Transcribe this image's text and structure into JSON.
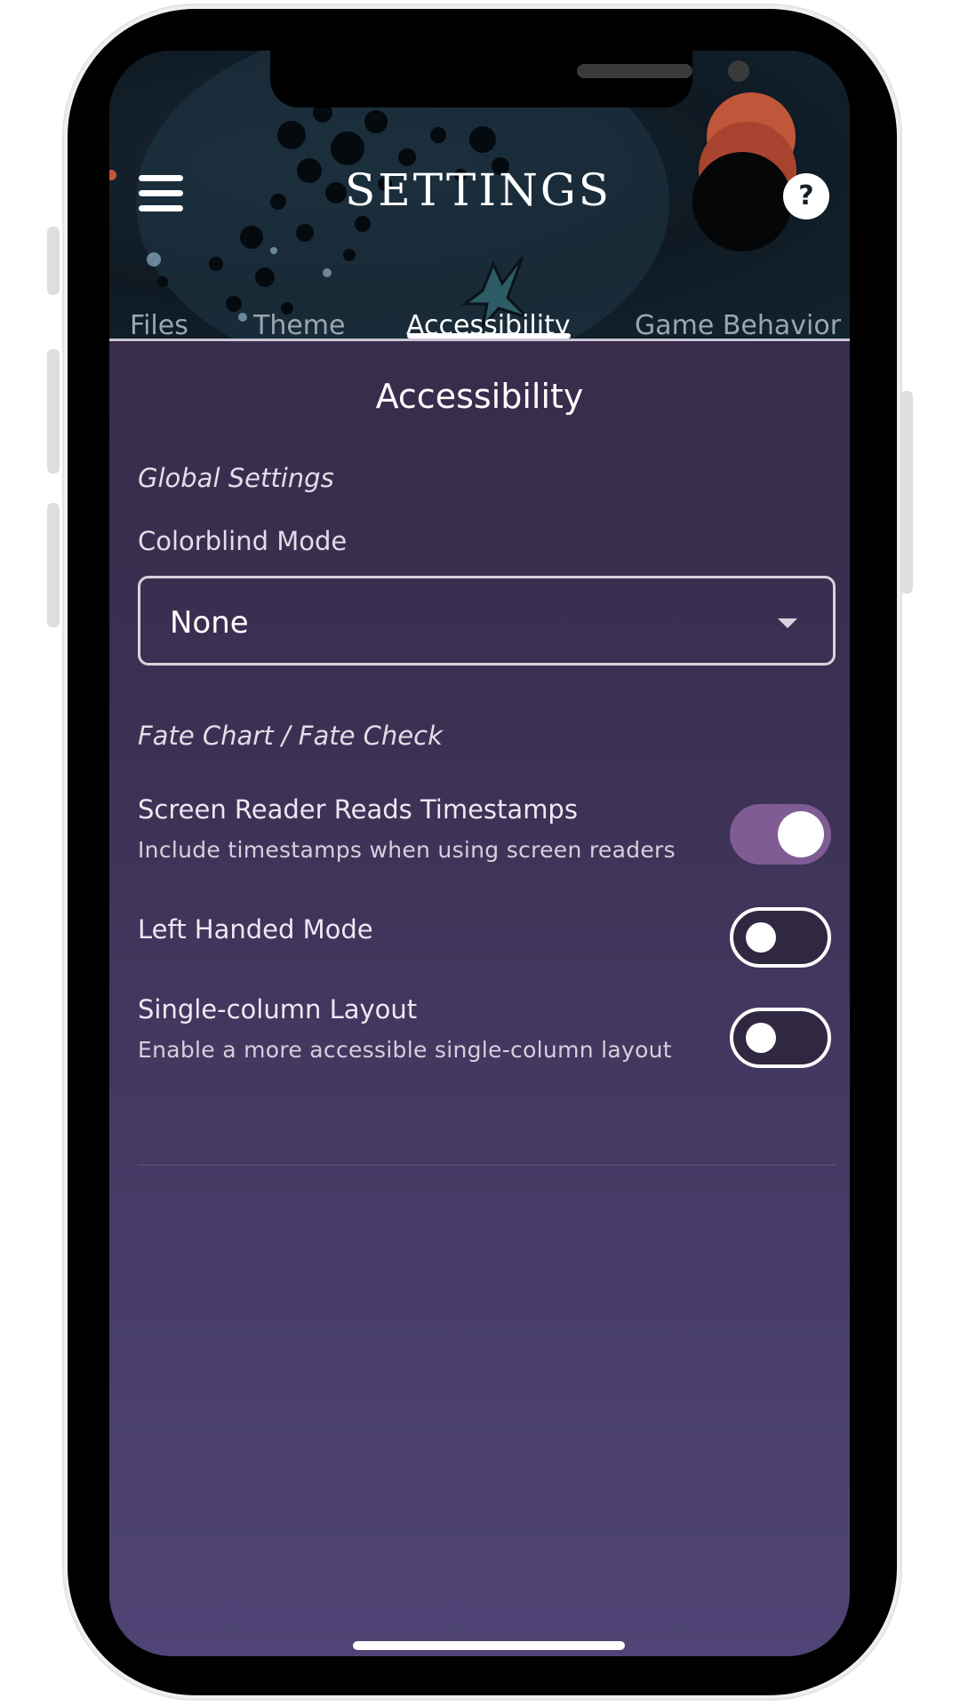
{
  "header": {
    "title": "SETTINGS",
    "menu_icon": "hamburger-menu-icon",
    "help_label": "?"
  },
  "tabs": [
    {
      "label": "Files",
      "active": false
    },
    {
      "label": "Theme",
      "active": false
    },
    {
      "label": "Accessibility",
      "active": true
    },
    {
      "label": "Game Behavior",
      "active": false
    }
  ],
  "content": {
    "section_title": "Accessibility",
    "global_group_label": "Global Settings",
    "colorblind": {
      "label": "Colorblind Mode",
      "selected": "None"
    },
    "fate_group_label": "Fate Chart / Fate Check",
    "settings": [
      {
        "title": "Screen Reader Reads Timestamps",
        "description": "Include timestamps when using screen readers",
        "enabled": true
      },
      {
        "title": "Left Handed Mode",
        "description": "",
        "enabled": false
      },
      {
        "title": "Single-column Layout",
        "description": "Enable a more accessible single-column layout",
        "enabled": false
      }
    ]
  },
  "colors": {
    "accent": "#7f5c93",
    "background_top": "#352a44",
    "background_bottom": "#4f4475",
    "header_dark": "#0f1a23"
  }
}
